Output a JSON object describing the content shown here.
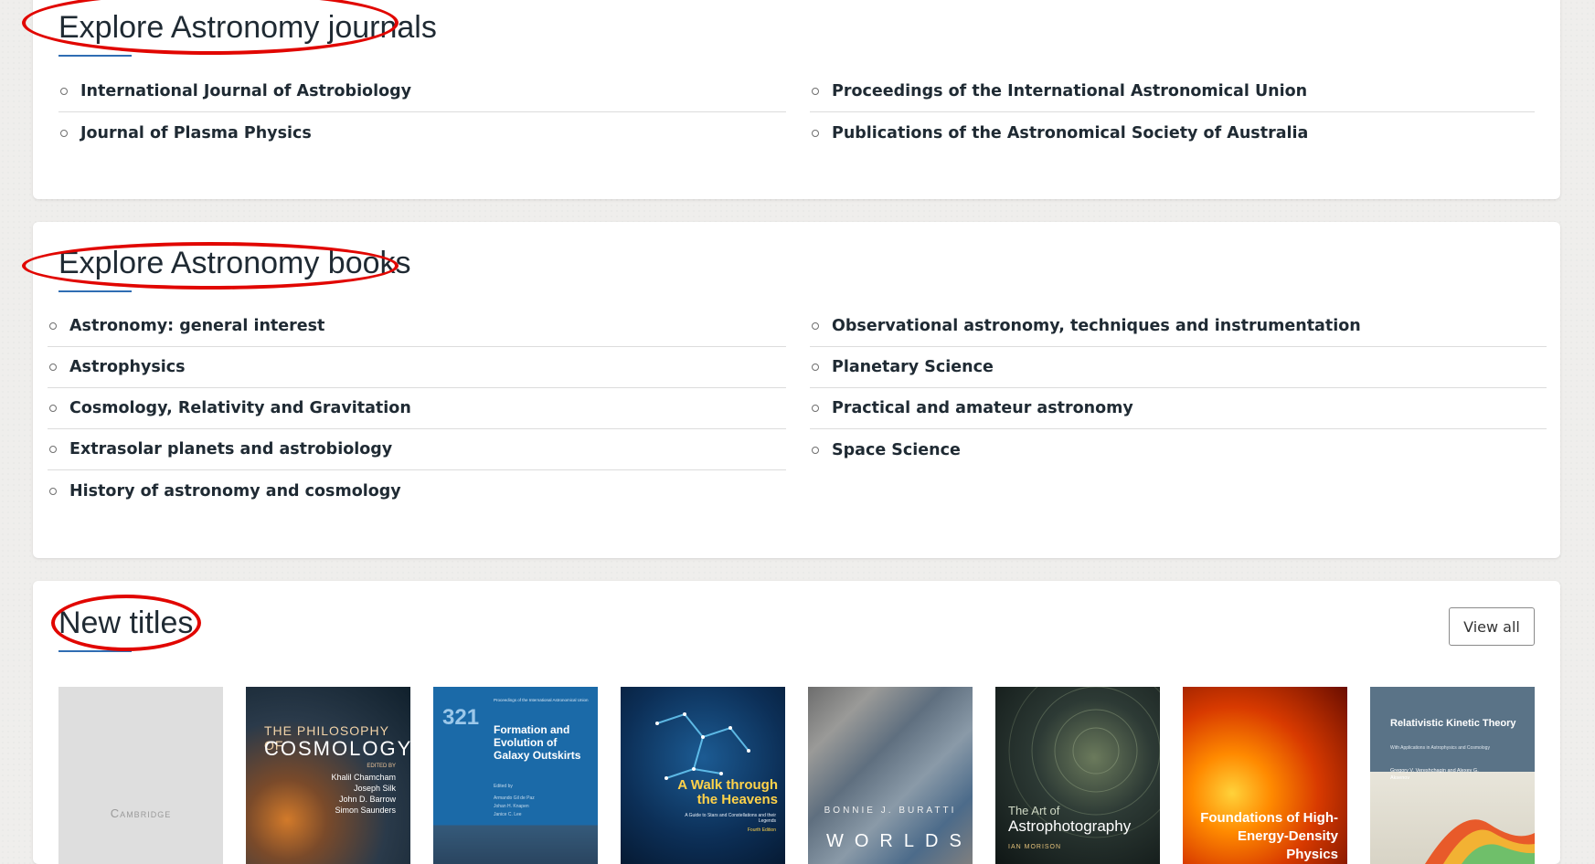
{
  "journals": {
    "title": "Explore Astronomy journals",
    "left": [
      "International Journal of Astrobiology",
      "Journal of Plasma Physics"
    ],
    "right": [
      "Proceedings of the International Astronomical Union",
      "Publications of the Astronomical Society of Australia"
    ]
  },
  "books": {
    "title": "Explore Astronomy books",
    "left": [
      "Astronomy: general interest",
      "Astrophysics",
      "Cosmology, Relativity and Gravitation",
      "Extrasolar planets and astrobiology",
      "History of astronomy and cosmology"
    ],
    "right": [
      "Observational astronomy, techniques and instrumentation",
      "Planetary Science",
      "Practical and amateur astronomy",
      "Space Science"
    ]
  },
  "new_titles": {
    "title": "New titles",
    "view_all": "View all",
    "covers": {
      "cambridge": {
        "logo": "Cambridge"
      },
      "cosmology": {
        "title_top": "THE PHILOSOPHY OF",
        "title_main": "COSMOLOGY",
        "edited_by": "EDITED BY",
        "authors": [
          "Khalil Chamcham",
          "Joseph Silk",
          "John D. Barrow",
          "Simon Saunders"
        ]
      },
      "galaxy": {
        "series": "Proceedings of the International Astronomical Union",
        "number": "321",
        "title": "Formation and Evolution of Galaxy Outskirts",
        "edited_by": "Edited by",
        "editors": [
          "Armando Gil de Paz",
          "Johan H. Knapen",
          "Janice C. Lee"
        ]
      },
      "heavens": {
        "title": "A Walk through the Heavens",
        "subtitle": "A Guide to Stars and Constellations and their Legends",
        "edition": "Fourth Edition"
      },
      "worlds": {
        "author": "BONNIE J. BURATTI",
        "title": "WORLDS"
      },
      "astrophoto": {
        "title_small": "The Art of",
        "title_main": "Astrophotography",
        "author": "IAN MORISON"
      },
      "hed": {
        "title": "Foundations of High-Energy-Density Physics"
      },
      "kinetic": {
        "title": "Relativistic Kinetic Theory",
        "subtitle": "With Applications in Astrophysics and Cosmology",
        "authors": "Gregory V. Vereshchagin and Alexey G. Aksenov"
      }
    }
  },
  "colors": {
    "accent": "#2f6db3",
    "highlight": "#e10600"
  }
}
